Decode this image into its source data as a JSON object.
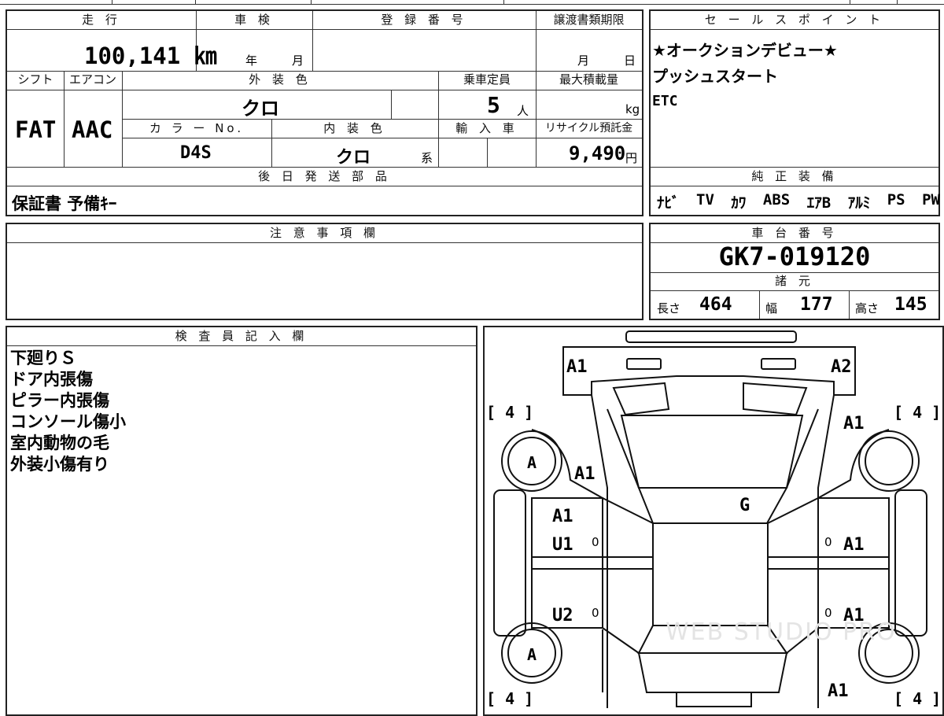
{
  "header": {
    "mileage_label": "走 行",
    "shaken_label": "車 検",
    "reg_label": "登 録 番 号",
    "transfer_label": "譲渡書類期限",
    "mileage_value": "100,141 ㎞",
    "year_unit": "年",
    "month_unit": "月",
    "transfer_month": "月",
    "transfer_day": "日"
  },
  "specs": {
    "shift_label": "シフト",
    "ac_label": "エアコン",
    "exterior_label": "外 装 色",
    "capacity_label": "乗車定員",
    "max_load_label": "最大積載量",
    "shift_value": "FAT",
    "ac_value": "AAC",
    "exterior_value": "クロ",
    "capacity_value": "5",
    "capacity_unit": "人",
    "load_unit": "kg",
    "color_no_label": "カ ラ ー No.",
    "interior_label": "内 装 色",
    "import_label": "輸 入 車",
    "recycle_label": "リサイクル預託金",
    "color_no_value": "D4S",
    "interior_value": "クロ",
    "interior_suffix": "系",
    "recycle_value": "9,490",
    "recycle_unit": "円"
  },
  "later_parts": {
    "label": "後 日 発 送 部 品",
    "value": "保証書 予備ｷｰ"
  },
  "sales_points": {
    "label": "セ ー ル ス ポ イ ン ト",
    "lines": [
      "★オークションデビュー★",
      "プッシュスタート",
      "ETC"
    ]
  },
  "equipment": {
    "label": "純 正 装 備",
    "items": [
      "ﾅﾋﾞ",
      "TV",
      "ｶﾜ",
      "ABS",
      "ｴｱB",
      "ｱﾙﾐ",
      "PS",
      "PW"
    ]
  },
  "caution": {
    "label": "注 意 事 項 欄"
  },
  "chassis": {
    "label": "車 台 番 号",
    "value": "GK7-019120",
    "dims_label": "諸 元",
    "length_label": "長さ",
    "length_value": "464",
    "width_label": "幅",
    "width_value": "177",
    "height_label": "高さ",
    "height_value": "145"
  },
  "inspector": {
    "label": "検 査 員 記 入 欄",
    "notes": [
      "下廻りＳ",
      "ドア内張傷",
      "ピラー内張傷",
      "コンソール傷小",
      "室内動物の毛",
      "外装小傷有り"
    ]
  },
  "diagram": {
    "tread": "[ 4 ]",
    "wheel": "A",
    "marks": {
      "front_left": "A1",
      "front_right": "A2",
      "right_fender": "A1",
      "left_fender": "A1",
      "roof": "G",
      "left_front_door": "A1",
      "left_front_door_2": "U1",
      "left_rear_door": "U2",
      "right_front_door": "A1",
      "right_rear_door": "A1",
      "right_rear": "A1",
      "zero": "0"
    },
    "watermark": "WEB STUDIO PRO"
  }
}
